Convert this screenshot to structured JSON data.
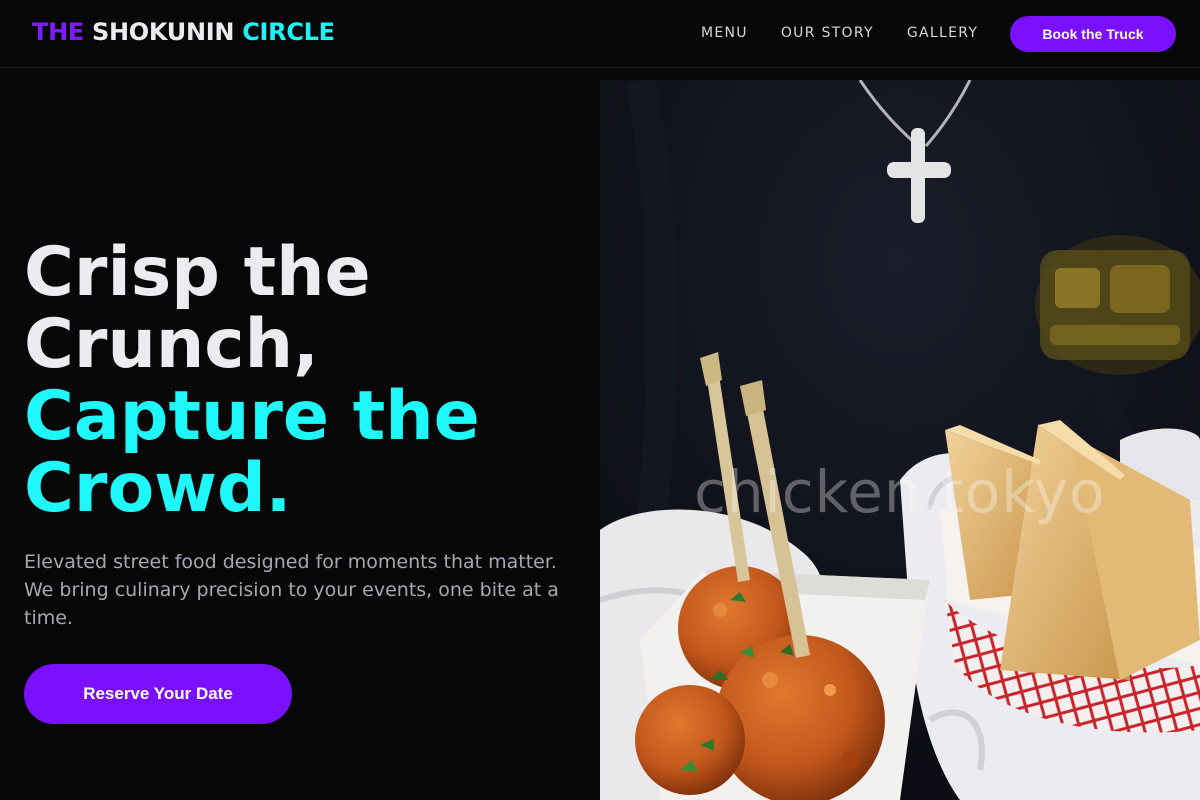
{
  "brand": {
    "word1": "THE",
    "word2": "SHOKUNIN",
    "word3": "CIRCLE"
  },
  "nav": {
    "links": [
      {
        "label": "MENU"
      },
      {
        "label": "OUR STORY"
      },
      {
        "label": "GALLERY"
      }
    ],
    "cta_label": "Book the Truck"
  },
  "hero": {
    "headline_line1": "Crisp the",
    "headline_line2": "Crunch,",
    "headline_line3": "Capture the",
    "headline_line4": "Crowd.",
    "subtext": "Elevated street food designed for moments that matter. We bring culinary precision to your events, one bite at a time.",
    "cta_label": "Reserve Your Date",
    "image_watermark": "chicken.tokyo"
  },
  "colors": {
    "background": "#070708",
    "accent_purple": "#7a10ff",
    "accent_cyan": "#1ff8fb",
    "text_light": "#ececf0",
    "text_muted": "#a7a7b2"
  }
}
